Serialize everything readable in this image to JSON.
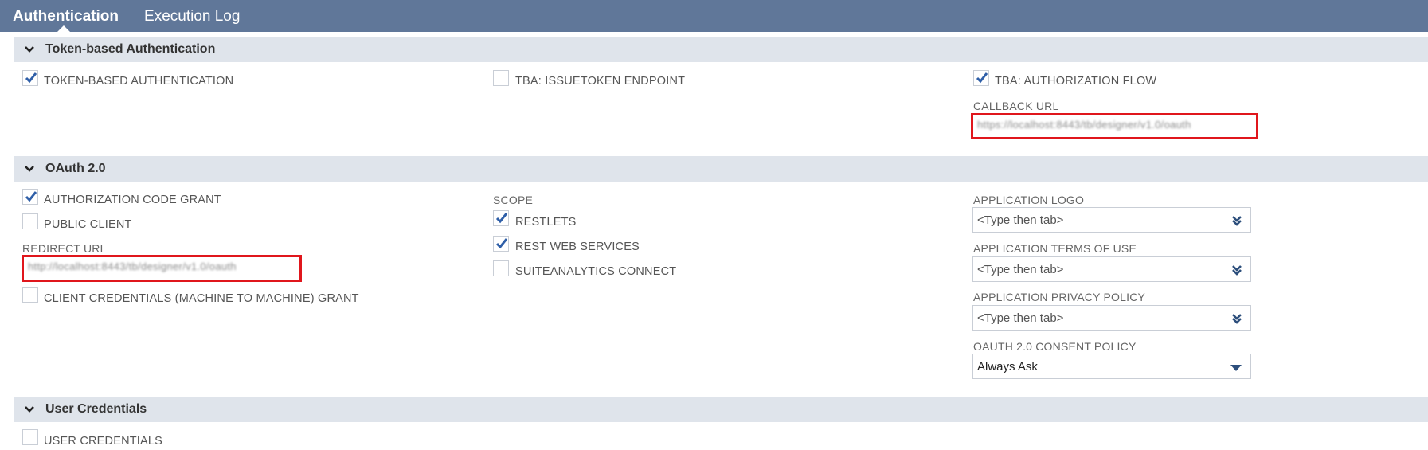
{
  "tabs": [
    {
      "label": "Authentication",
      "underline": "A",
      "rest": "uthentication"
    },
    {
      "label": "Execution Log",
      "underline": "E",
      "rest": "xecution Log"
    }
  ],
  "sections": {
    "tba": {
      "title": "Token-based Authentication"
    },
    "oauth": {
      "title": "OAuth 2.0"
    },
    "user": {
      "title": "User Credentials"
    }
  },
  "tba": {
    "token_based_auth": {
      "label": "TOKEN-BASED AUTHENTICATION",
      "checked": true
    },
    "issuetoken_endpoint": {
      "label": "TBA: ISSUETOKEN ENDPOINT",
      "checked": false
    },
    "authorization_flow": {
      "label": "TBA: AUTHORIZATION FLOW",
      "checked": true
    },
    "callback_url_label": "CALLBACK URL",
    "callback_url_value": "https://localhost:8443/tb/designer/v1.0/oauth"
  },
  "oauth": {
    "auth_code_grant": {
      "label": "AUTHORIZATION CODE GRANT",
      "checked": true
    },
    "public_client": {
      "label": "PUBLIC CLIENT",
      "checked": false
    },
    "redirect_url_label": "REDIRECT URL",
    "redirect_url_value": "http://localhost:8443/tb/designer/v1.0/oauth",
    "client_credentials": {
      "label": "CLIENT CREDENTIALS (MACHINE TO MACHINE) GRANT",
      "checked": false
    },
    "scope_label": "SCOPE",
    "restlets": {
      "label": "RESTLETS",
      "checked": true
    },
    "rest_web_services": {
      "label": "REST WEB SERVICES",
      "checked": true
    },
    "suiteanalytics": {
      "label": "SUITEANALYTICS CONNECT",
      "checked": false
    },
    "app_logo": {
      "label": "APPLICATION LOGO",
      "placeholder": "<Type then tab>"
    },
    "app_terms": {
      "label": "APPLICATION TERMS OF USE",
      "placeholder": "<Type then tab>"
    },
    "app_privacy": {
      "label": "APPLICATION PRIVACY POLICY",
      "placeholder": "<Type then tab>"
    },
    "consent_policy": {
      "label": "OAUTH 2.0 CONSENT POLICY",
      "value": "Always Ask"
    }
  },
  "user": {
    "user_credentials": {
      "label": "USER CREDENTIALS",
      "checked": false
    }
  },
  "colors": {
    "tabbar": "#607799",
    "section": "#dfe4eb",
    "check": "#2f5fa8",
    "highlight": "#e0161c"
  }
}
